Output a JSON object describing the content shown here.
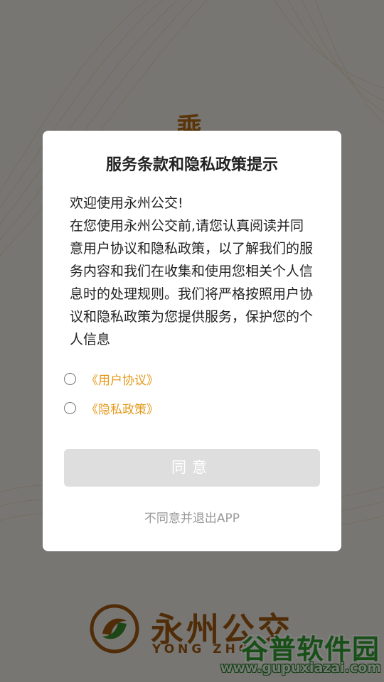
{
  "splash": {
    "mark_char": "乘",
    "brand_name": "永州公交",
    "brand_pinyin": "YONG ZHOU",
    "logo_icon": "yongzhou-bus-logo-icon"
  },
  "dialog": {
    "title": "服务条款和隐私政策提示",
    "welcome": "欢迎使用永州公交!",
    "body": "在您使用永州公交前,请您认真阅读并同意用户协议和隐私政策，以了解我们的服务内容和我们在收集和使用您相关个人信息时的处理规则。我们将严格按照用户协议和隐私政策为您提供服务，保护您的个人信息",
    "consents": [
      {
        "label": "《用户协议》",
        "checked": false
      },
      {
        "label": "《隐私政策》",
        "checked": false
      }
    ],
    "agree_label": "同意",
    "decline_label": "不同意并退出APP"
  },
  "watermark": {
    "title": "谷普软件园",
    "url": "www.gupuxiazai.com"
  },
  "colors": {
    "accent": "#e39a1c",
    "brand": "#a05a10",
    "button_disabled": "#dedede",
    "watermark_green": "#2f9e2f"
  }
}
